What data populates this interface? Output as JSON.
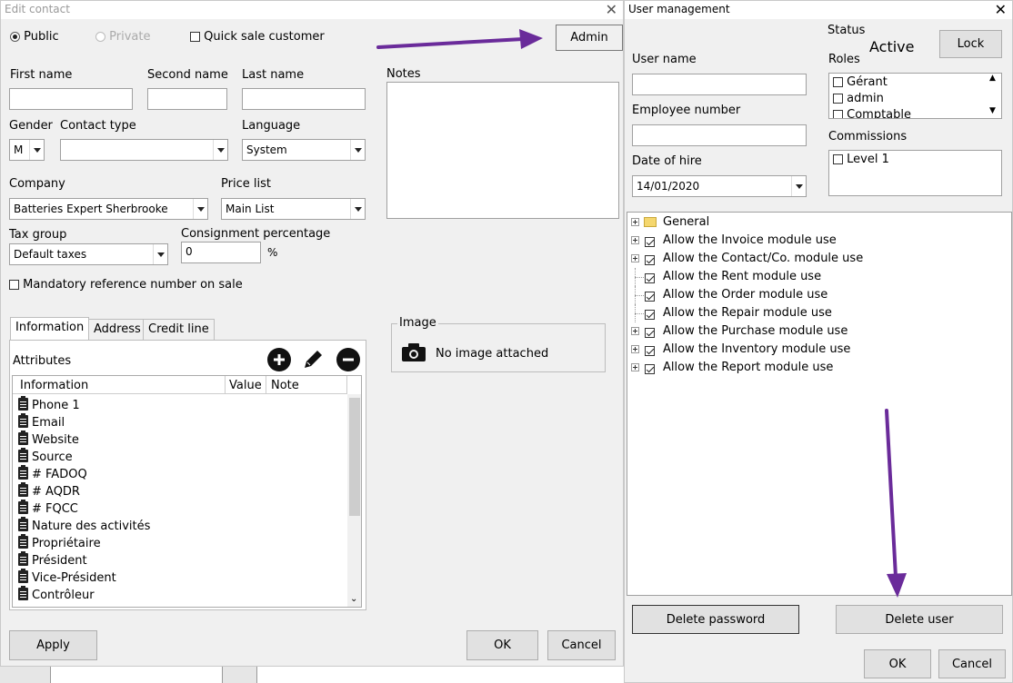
{
  "edit_contact": {
    "title": "Edit contact",
    "visibility": {
      "public": "Public",
      "private": "Private",
      "quick_sale": "Quick sale customer"
    },
    "admin_button": "Admin",
    "first_name_label": "First name",
    "second_name_label": "Second name",
    "last_name_label": "Last name",
    "notes_label": "Notes",
    "gender_label": "Gender",
    "gender_value": "M",
    "contact_type_label": "Contact type",
    "language_label": "Language",
    "language_value": "System",
    "company_label": "Company",
    "company_value": "Batteries Expert Sherbrooke",
    "price_list_label": "Price list",
    "price_list_value": "Main List",
    "tax_group_label": "Tax group",
    "tax_group_value": "Default taxes",
    "consignment_label": "Consignment percentage",
    "consignment_value": "0",
    "percent_sign": "%",
    "mandatory_ref_label": "Mandatory reference number on sale",
    "tabs": [
      "Information",
      "Address",
      "Credit line"
    ],
    "attributes_label": "Attributes",
    "columns": [
      "Information",
      "Value",
      "Note"
    ],
    "attributes": [
      "Phone 1",
      "Email",
      "Website",
      "Source",
      "# FADOQ",
      "# AQDR",
      "# FQCC",
      "Nature des activités",
      "Propriétaire",
      "Président",
      "Vice-Président",
      "Contrôleur"
    ],
    "image_label": "Image",
    "no_image": "No image attached",
    "apply_button": "Apply",
    "ok_button": "OK",
    "cancel_button": "Cancel"
  },
  "user_management": {
    "title": "User management",
    "status_label": "Status",
    "status_value": "Active",
    "lock_button": "Lock",
    "user_name_label": "User name",
    "roles_label": "Roles",
    "roles": [
      "Gérant",
      "admin",
      "Comptable"
    ],
    "employee_number_label": "Employee number",
    "commissions_label": "Commissions",
    "commissions": [
      "Level 1"
    ],
    "date_of_hire_label": "Date of hire",
    "date_of_hire_value": "14/01/2020",
    "permissions": [
      {
        "label": "General",
        "type": "folder",
        "expandable": true
      },
      {
        "label": "Allow the Invoice module use",
        "checked": true,
        "expandable": true
      },
      {
        "label": "Allow the Contact/Co. module use",
        "checked": true,
        "expandable": true
      },
      {
        "label": "Allow the Rent module use",
        "checked": true,
        "expandable": false
      },
      {
        "label": "Allow the Order module use",
        "checked": true,
        "expandable": false
      },
      {
        "label": "Allow the Repair module use",
        "checked": true,
        "expandable": false
      },
      {
        "label": "Allow the Purchase module use",
        "checked": true,
        "expandable": true
      },
      {
        "label": "Allow the Inventory module use",
        "checked": true,
        "expandable": true
      },
      {
        "label": "Allow the Report module use",
        "checked": true,
        "expandable": true
      }
    ],
    "delete_password_button": "Delete password",
    "delete_user_button": "Delete user",
    "ok_button": "OK",
    "cancel_button": "Cancel"
  },
  "colors": {
    "annotation_arrow": "#6a2b9a",
    "folder": "#f5d76e"
  }
}
